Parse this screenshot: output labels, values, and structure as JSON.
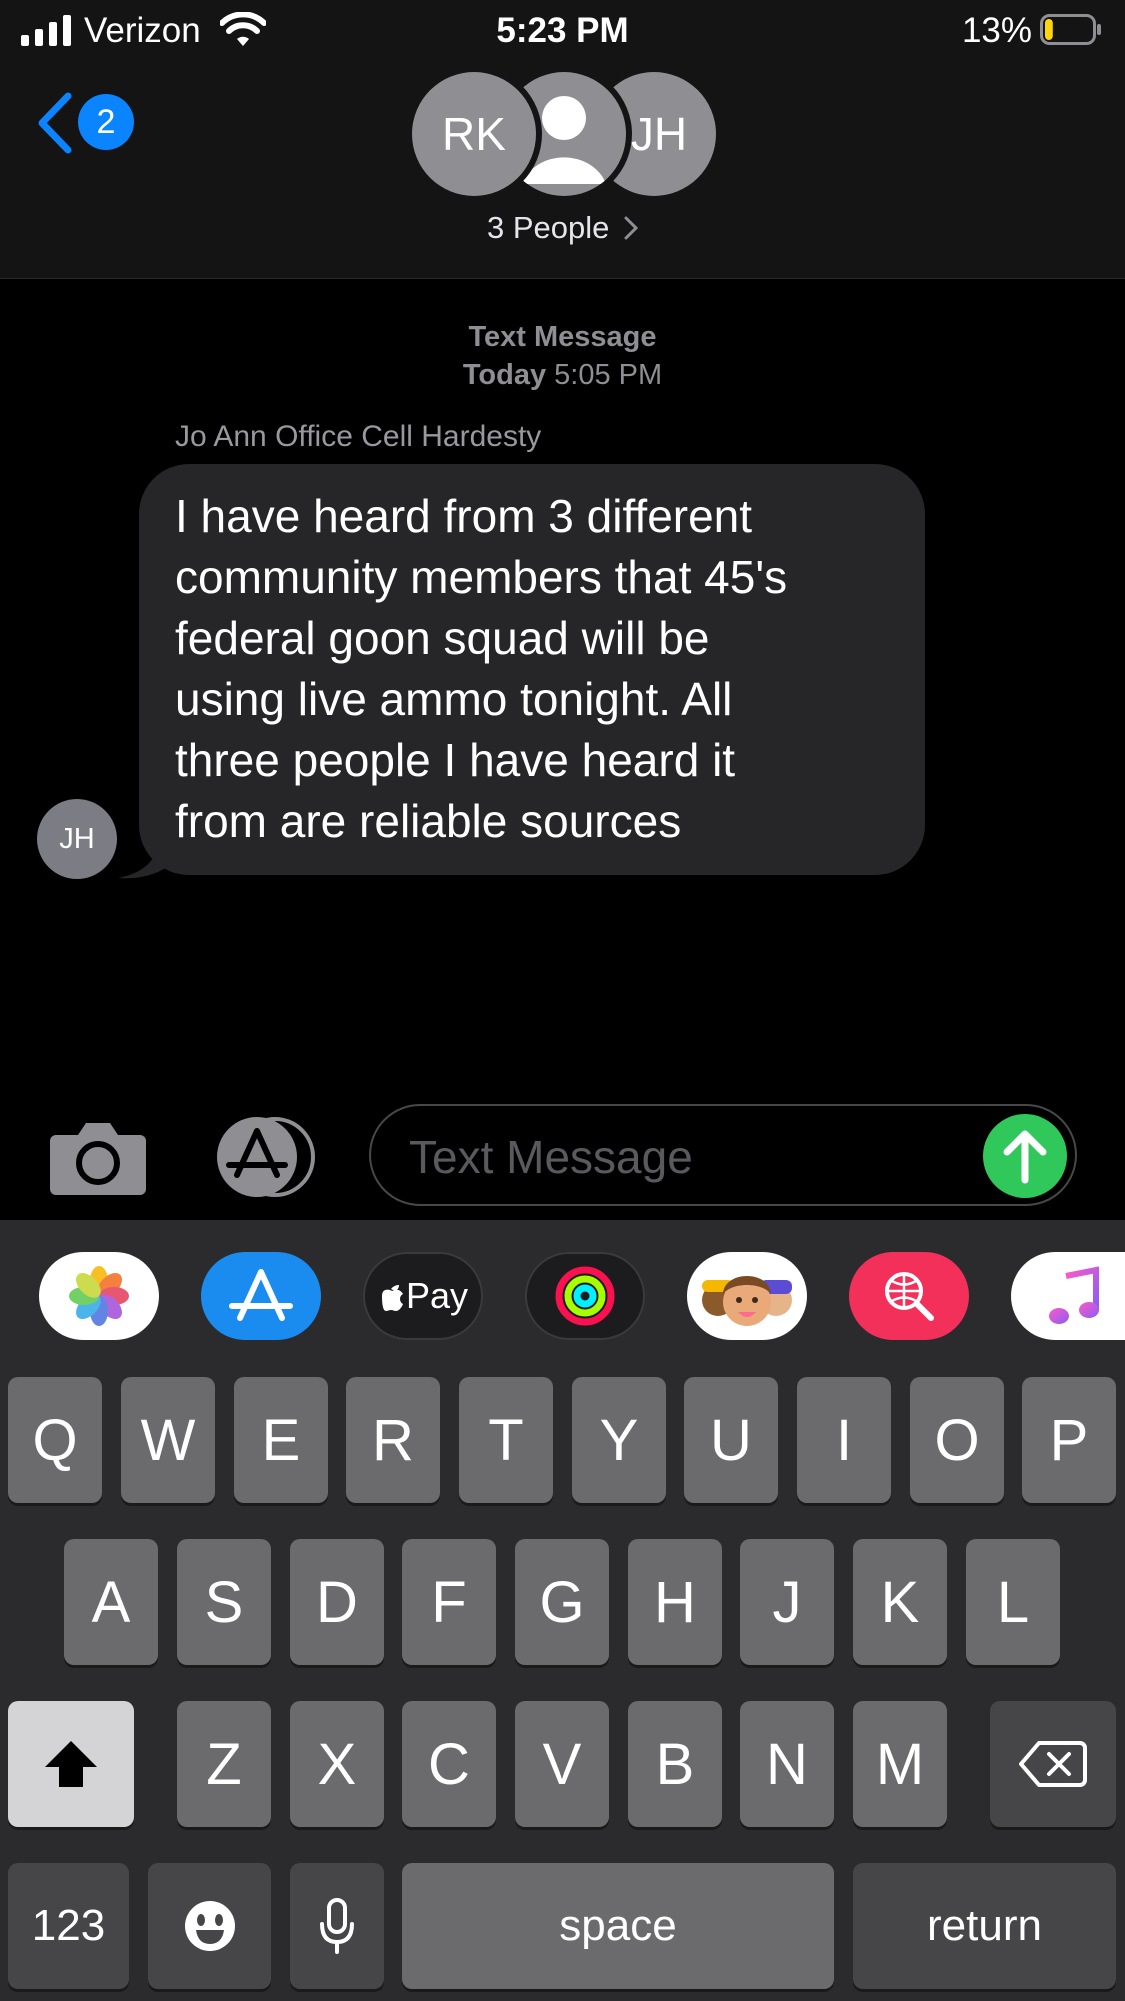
{
  "status_bar": {
    "carrier": "Verizon",
    "time": "5:23 PM",
    "battery_percent": "13%",
    "battery_level": 0.13
  },
  "header": {
    "back_badge": "2",
    "avatars": [
      "RK",
      "JH"
    ],
    "group_title": "3 People"
  },
  "conversation": {
    "kind": "Text Message",
    "date_day": "Today",
    "date_time": "5:05 PM",
    "messages": [
      {
        "sender": "Jo Ann Office Cell Hardesty",
        "avatar": "JH",
        "text": "I have heard from 3 different\ncommunity members that 45's\nfederal goon squad will be\nusing live ammo tonight.  All\nthree people I have heard it\nfrom are reliable sources"
      }
    ]
  },
  "input": {
    "placeholder": "Text Message"
  },
  "app_drawer": [
    {
      "name": "photos-app",
      "icon": "photos-icon"
    },
    {
      "name": "app-store",
      "icon": "app-store-icon"
    },
    {
      "name": "apple-pay",
      "label": "Pay"
    },
    {
      "name": "activity",
      "icon": "activity-rings-icon"
    },
    {
      "name": "memoji",
      "icon": "memoji-icon"
    },
    {
      "name": "image-search",
      "icon": "globe-search-icon"
    },
    {
      "name": "music",
      "icon": "music-note-icon"
    }
  ],
  "keyboard": {
    "row1": [
      "Q",
      "W",
      "E",
      "R",
      "T",
      "Y",
      "U",
      "I",
      "O",
      "P"
    ],
    "row2": [
      "A",
      "S",
      "D",
      "F",
      "G",
      "H",
      "J",
      "K",
      "L"
    ],
    "row3": [
      "Z",
      "X",
      "C",
      "V",
      "B",
      "N",
      "M"
    ],
    "numbers_label": "123",
    "space_label": "space",
    "return_label": "return"
  },
  "colors": {
    "accent": "#0a84ff",
    "send": "#30c85a",
    "bubble": "#262628"
  }
}
